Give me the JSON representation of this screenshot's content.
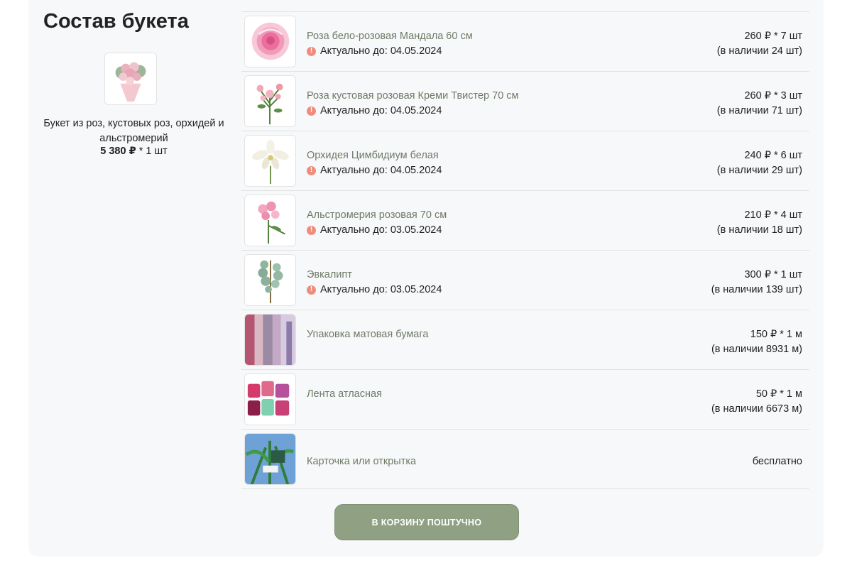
{
  "bouquet": {
    "title": "Состав букета",
    "name": "Букет из роз, кустовых роз, орхидей и альстромерий",
    "price": "5 380 ₽",
    "qty": "* 1 шт"
  },
  "items": [
    {
      "name": "Роза бело-розовая Мандала 60 см",
      "actual": "Актуально до: 04.05.2024",
      "price": "260 ₽ * 7 шт",
      "stock": "(в наличии 24 шт)",
      "icon": "pink-rose-icon"
    },
    {
      "name": "Роза кустовая розовая Креми Твистер 70 см",
      "actual": "Актуально до: 04.05.2024",
      "price": "260 ₽ * 3 шт",
      "stock": "(в наличии 71 шт)",
      "icon": "spray-rose-icon"
    },
    {
      "name": "Орхидея Цимбидиум белая",
      "actual": "Актуально до: 04.05.2024",
      "price": "240 ₽ * 6 шт",
      "stock": "(в наличии 29 шт)",
      "icon": "orchid-icon"
    },
    {
      "name": "Альстромерия розовая 70 см",
      "actual": "Актуально до: 03.05.2024",
      "price": "210 ₽ * 4 шт",
      "stock": "(в наличии 18 шт)",
      "icon": "alstroemeria-icon"
    },
    {
      "name": "Эвкалипт",
      "actual": "Актуально до: 03.05.2024",
      "price": "300 ₽ * 1 шт",
      "stock": "(в наличии 139 шт)",
      "icon": "eucalyptus-icon"
    },
    {
      "name": "Упаковка матовая бумага",
      "price": "150 ₽ * 1 м",
      "stock": "(в наличии 8931 м)",
      "icon": "wrapping-paper-icon"
    },
    {
      "name": "Лента атласная",
      "price": "50 ₽ * 1 м",
      "stock": "(в наличии 6673 м)",
      "icon": "satin-ribbon-icon"
    },
    {
      "name": "Карточка или открытка",
      "price": "бесплатно",
      "icon": "greeting-card-icon"
    }
  ],
  "cart_button": "В КОРЗИНУ ПОШТУЧНО",
  "warn_glyph": "!",
  "colors": {
    "accent": "#8fa083",
    "item_name": "#6e7a66",
    "warning": "#ef8d7c",
    "panel": "#f7f8fa"
  }
}
